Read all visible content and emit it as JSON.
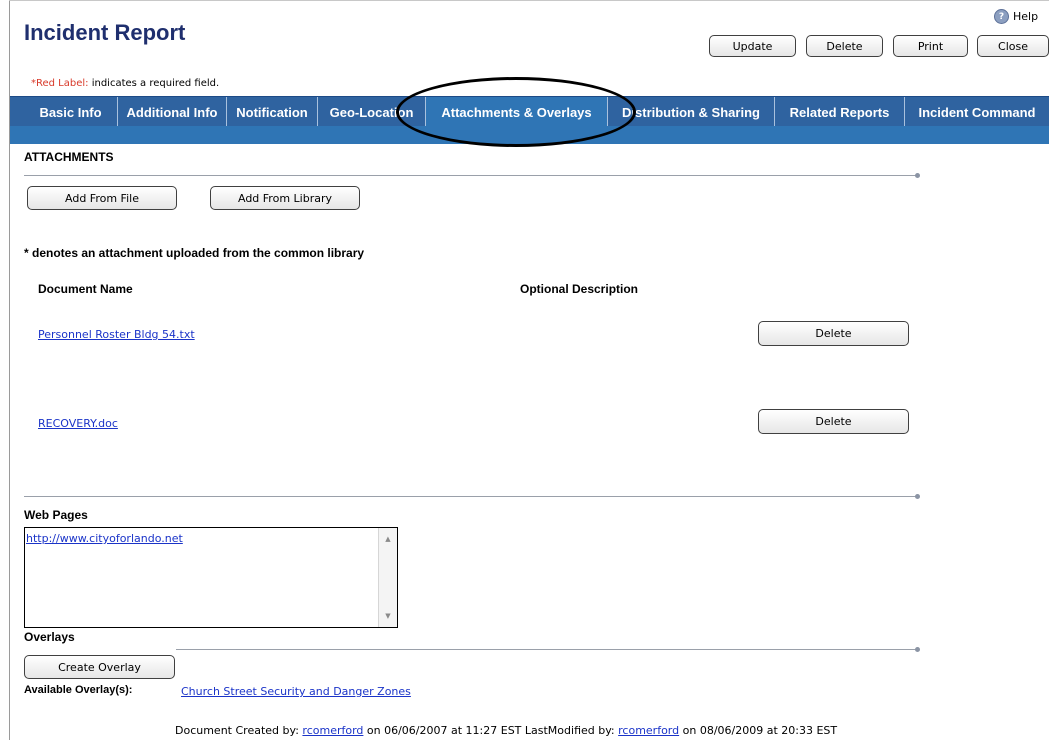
{
  "header": {
    "title": "Incident Report",
    "help_label": "Help",
    "buttons": {
      "update": "Update",
      "delete": "Delete",
      "print": "Print",
      "close": "Close"
    },
    "required_note": {
      "red_part": "*Red Label:",
      "rest": " indicates a required field."
    }
  },
  "tabs": [
    {
      "label": "Basic Info"
    },
    {
      "label": "Additional Info"
    },
    {
      "label": "Notification"
    },
    {
      "label": "Geo-Location"
    },
    {
      "label": "Attachments & Overlays"
    },
    {
      "label": "Distribution & Sharing"
    },
    {
      "label": "Related Reports"
    },
    {
      "label": "Incident Command"
    }
  ],
  "active_tab": "Attachments & Overlays",
  "attachments": {
    "heading": "ATTACHMENTS",
    "add_from_file": "Add From File",
    "add_from_library": "Add From Library",
    "note": "* denotes an attachment uploaded from the common library",
    "col_document_name": "Document Name",
    "col_optional_description": "Optional Description",
    "rows": [
      {
        "name": "Personnel Roster Bldg 54.txt",
        "delete_label": "Delete"
      },
      {
        "name": "RECOVERY.doc",
        "delete_label": "Delete"
      }
    ]
  },
  "web_pages": {
    "heading": "Web Pages",
    "items": [
      "http://www.cityoforlando.net"
    ]
  },
  "overlays": {
    "heading": "Overlays",
    "create_label": "Create Overlay",
    "available_label": "Available Overlay(s):",
    "available_link": "Church Street Security and Danger Zones"
  },
  "footer": {
    "created_prefix": "Document Created by: ",
    "created_by": "rcomerford",
    "created_on": " on 06/06/2007 at 11:27 EST LastModified by: ",
    "modified_by": "rcomerford",
    "modified_on": " on 08/06/2009 at 20:33 EST"
  },
  "colors": {
    "tab_bar": "#2f63a0",
    "active_tab": "#2f75b5",
    "title": "#1f2f6e",
    "required_red": "#d83a2a",
    "link": "#1a33c8"
  }
}
